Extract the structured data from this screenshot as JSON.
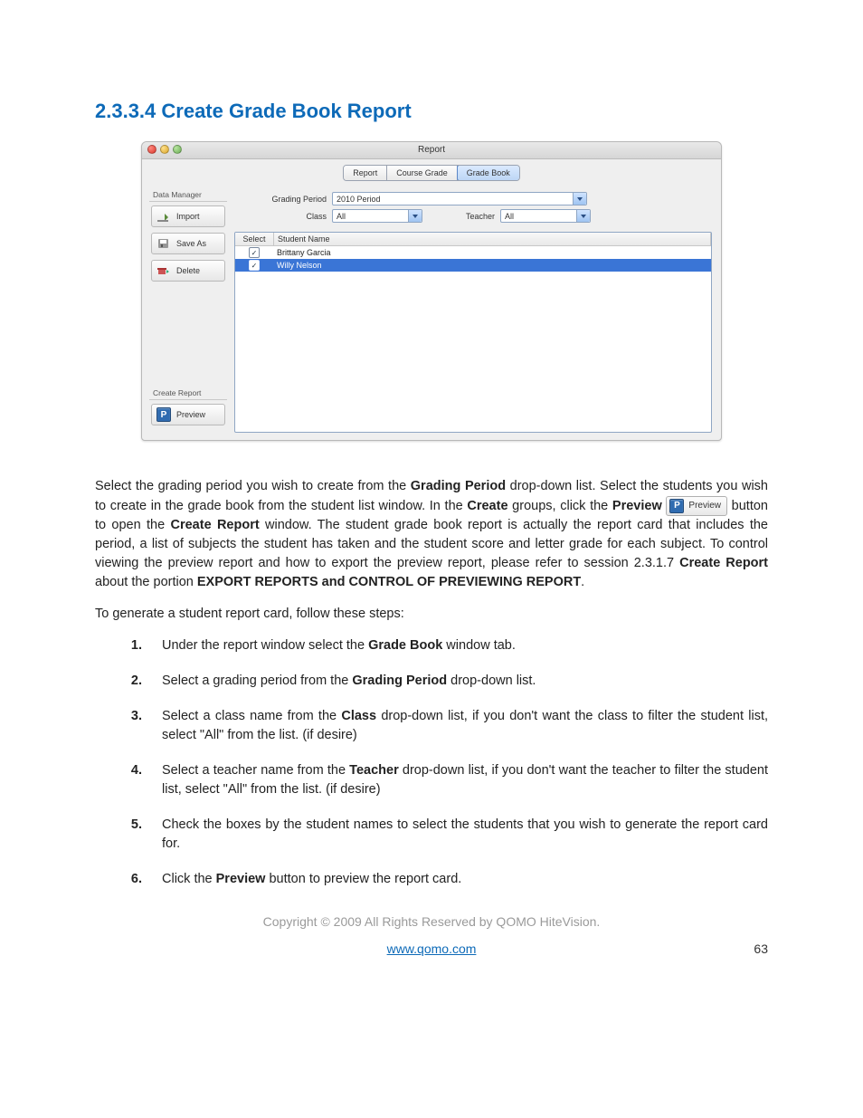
{
  "heading": "2.3.3.4 Create Grade Book Report",
  "window": {
    "title": "Report",
    "tabs": {
      "t0": "Report",
      "t1": "Course Grade",
      "t2": "Grade Book"
    },
    "sidebar": {
      "group1_title": "Data Manager",
      "import_label": "Import",
      "saveas_label": "Save As",
      "delete_label": "Delete",
      "group2_title": "Create Report",
      "preview_label": "Preview"
    },
    "filters": {
      "grading_period_label": "Grading Period",
      "grading_period_value": "2010 Period",
      "class_label": "Class",
      "class_value": "All",
      "teacher_label": "Teacher",
      "teacher_value": "All"
    },
    "table": {
      "col_select": "Select",
      "col_name": "Student Name",
      "rows": {
        "r0": {
          "name": "Brittany Garcia"
        },
        "r1": {
          "name": "Willy Nelson"
        }
      }
    }
  },
  "text": {
    "p1_a": "Select the grading period you wish to create from the ",
    "p1_b": "Grading Period",
    "p1_c": " drop-down list. Select the students you wish to create in the grade book from the student list window. In the ",
    "p1_d": "Create",
    "p1_e": " groups, click the ",
    "p1_f": "Preview",
    "p1_g": " button to open the ",
    "p1_h": "Create Report",
    "p1_i": " window. The student grade book report is actually the report card that includes the period, a list of subjects the student has taken and the student score and letter grade for each subject. To control viewing the preview report and how to export the preview report, please refer to session 2.3.1.7 ",
    "p1_j": "Create Report",
    "p1_k": " about the portion ",
    "p1_l": "EXPORT REPORTS and CONTROL OF PREVIEWING REPORT",
    "p1_m": ".",
    "p2": "To generate a student report card, follow these steps:",
    "preview_btn_label": "Preview"
  },
  "steps": {
    "s1a": "Under the report window select the ",
    "s1b": "Grade Book",
    "s1c": " window tab.",
    "s2a": "Select a grading period from the ",
    "s2b": "Grading Period",
    "s2c": " drop-down list.",
    "s3a": "Select a class name from the ",
    "s3b": "Class",
    "s3c": " drop-down list, if you don't want the class to filter the student list, select \"All\" from the list. (if desire)",
    "s4a": "Select a teacher name from the ",
    "s4b": "Teacher",
    "s4c": " drop-down list, if you don't want the teacher to filter the student list, select \"All\" from the list. (if desire)",
    "s5": "Check the boxes by the student names to select the students that you wish to generate the report card for.",
    "s6a": "Click the ",
    "s6b": "Preview",
    "s6c": " button to preview the report card."
  },
  "footer": {
    "copyright": "Copyright © 2009 All Rights Reserved by QOMO HiteVision.",
    "link": "www.qomo.com",
    "page": "63"
  }
}
